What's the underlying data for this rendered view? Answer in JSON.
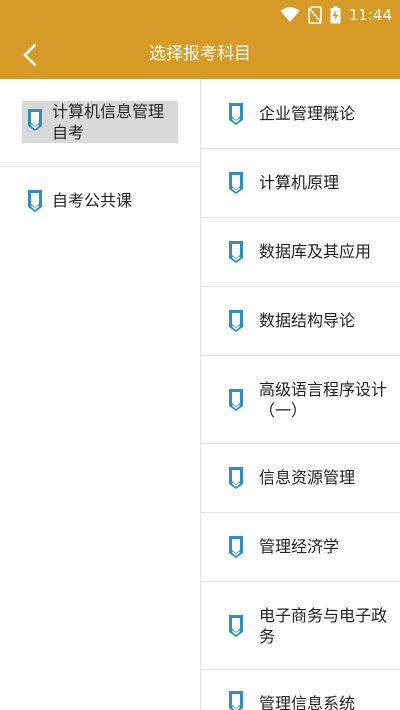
{
  "status_bar": {
    "time": "11:44",
    "icons": [
      "wifi-icon",
      "no-sim-icon",
      "battery-charging-icon"
    ]
  },
  "app_bar": {
    "title": "选择报考科目",
    "back_icon": "chevron-left-icon"
  },
  "colors": {
    "primary": "#d69a27",
    "icon_blue": "#2f8fc1",
    "selected_bg": "#d9d9d9",
    "divider": "#e6e6e6"
  },
  "categories": [
    {
      "label": "计算机信息管理自考",
      "selected": true
    },
    {
      "label": "自考公共课",
      "selected": false
    }
  ],
  "subjects": [
    {
      "label": "企业管理概论"
    },
    {
      "label": "计算机原理"
    },
    {
      "label": "数据库及其应用"
    },
    {
      "label": "数据结构导论"
    },
    {
      "label": "高级语言程序设计（一）"
    },
    {
      "label": "信息资源管理"
    },
    {
      "label": "管理经济学"
    },
    {
      "label": "电子商务与电子政务"
    },
    {
      "label": "管理信息系统"
    }
  ]
}
